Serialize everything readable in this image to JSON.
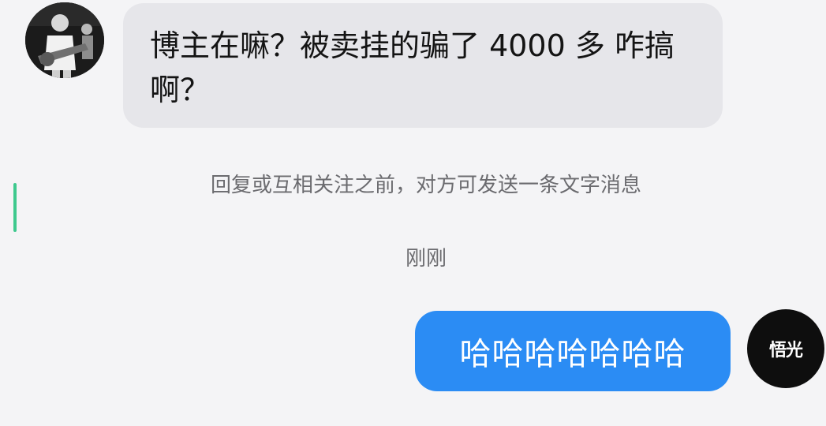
{
  "conversation": {
    "incoming": {
      "message": "博主在嘛？被卖挂的骗了 4000 多 咋搞啊？"
    },
    "notice": "回复或互相关注之前，对方可发送一条文字消息",
    "timestamp": "刚刚",
    "outgoing": {
      "message": "哈哈哈哈哈哈哈",
      "avatar_label": "悟光"
    }
  },
  "colors": {
    "background": "#f4f4f6",
    "incoming_bubble": "#e6e6ea",
    "outgoing_bubble": "#2b8cf4",
    "meta_text": "#6b6b6f"
  }
}
